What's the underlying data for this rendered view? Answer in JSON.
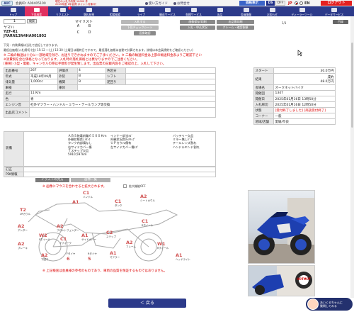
{
  "top": {
    "logo": "AUC",
    "member": "会員ID: A00405100",
    "notice_line1": "現在の入札予約数 10000 件",
    "notice_line2": "2025年度 1年会費 ポイント対象中！",
    "links": [
      "使い方ガイド",
      "お問合せ"
    ],
    "buttons": [
      "価格表示",
      "DS",
      "OFF"
    ],
    "lang_jp": "JP",
    "lang_en": "EN",
    "logout": "ログアウト"
  },
  "nav": [
    {
      "label": "トップ",
      "active": false
    },
    {
      "label": "下見検索",
      "active": true
    },
    {
      "label": "リクエスト",
      "active": false,
      "badge": "1"
    },
    {
      "label": "落札結果",
      "active": false
    },
    {
      "label": "相場検索",
      "active": false
    },
    {
      "label": "ライブ",
      "active": false
    },
    {
      "label": "輸送サービス",
      "active": false
    },
    {
      "label": "各種サービス",
      "active": false
    },
    {
      "label": "出品",
      "active": false
    },
    {
      "label": "会員情報",
      "active": false
    },
    {
      "label": "お知らせ",
      "active": false
    },
    {
      "label": "ディーラーツール",
      "active": false
    },
    {
      "label": "データサービス",
      "active": false
    }
  ],
  "lot": {
    "number": "1",
    "search": "検索",
    "maker": "ヤマハ",
    "model": "YZF-R1",
    "frame": "JYARN13N4HA001802",
    "mylist_label": "マイリスト",
    "mylist": [
      "A",
      "B",
      "C",
      "D"
    ]
  },
  "actions": {
    "row1": [
      "入札する",
      "画像保存/印刷",
      "出品票印刷"
    ],
    "row2": [
      "下見チェックシート",
      "入札・申込状況",
      "クレーム・確認依頼"
    ],
    "row3": [
      "画像確認"
    ],
    "page": "1/1",
    "top_right": "目録"
  },
  "notes": {
    "n1": "下見・内装情報は当社で追記しております。",
    "n2": "最低出価格/入札締切:(金) 15:12 ～(土) 12:30 (土曜日は最終日ですので、最低落札価格は自動で計算されます。詳細は本会員規約をご確認ください)",
    "red1": "※ 二輪の輸送は十分に一部地域を除き、お送りできかねますのでご了承ください。※ 二輪の輸送料金は上部の輸送料金表よりご確認下さい",
    "red2": "※消費税額(9,0%)",
    "red3": "※消費税を含む価格となっております。入札時の落札価格とは異なりますのでご注意ください。",
    "red4": "[重要] 小型・電動、キャンセルの際は手数料が発生致します。出品票の記載内容をご確認の上、入札して下さい。"
  },
  "spec": {
    "rows": [
      {
        "h1": "出品番号",
        "v1": "267",
        "h2": "評価点",
        "v2": "4",
        "h3": "色区分",
        "v3": "",
        "h4": "",
        "v4": ""
      },
      {
        "h1": "年式",
        "v1": "平成18年09月",
        "h2": "外装",
        "v2": "B",
        "h3": "シフト",
        "v3": "",
        "h4": "",
        "v4": ""
      },
      {
        "h1": "排気量",
        "v1": "1,000cc",
        "h2": "機関",
        "v2": "B",
        "h3": "足回り",
        "v3": "",
        "h4": "",
        "v4": ""
      },
      {
        "h1": "車検",
        "v1": "",
        "h2": "車体",
        "v2": "",
        "h3": "",
        "v3": "",
        "h4": "",
        "v4": ""
      },
      {
        "h1": "走行",
        "v1": "11 Km",
        "h2": "",
        "v2": "",
        "h3": "",
        "v3": "",
        "h4": "",
        "v4": ""
      },
      {
        "h1": "色",
        "v1": "青",
        "h2": "",
        "v2": "",
        "h3": "",
        "v3": "",
        "h4": "",
        "v4": ""
      },
      {
        "h1": "エンジン音",
        "v1": "社外マフラー・ハンドル・ミラー・テールランプ等交換",
        "h2": "",
        "v2": "",
        "h3": "",
        "v3": "",
        "h4": "",
        "v4": ""
      },
      {
        "h1": "出品店コメント",
        "v1": "",
        "h2": "",
        "v2": "",
        "h3": "",
        "v3": "",
        "h4": "",
        "v4": ""
      }
    ]
  },
  "info": {
    "start_label": "スタート",
    "start_value": "30.0万円",
    "result_label": "結果",
    "result_value_top": "成約",
    "result_value": "48.0万円",
    "rows": [
      {
        "h": "会場名",
        "v": "オークネットバイク"
      },
      {
        "h": "開催回",
        "v": "1347"
      },
      {
        "h": "開催日",
        "v": "2025年01月16日 13時50分"
      },
      {
        "h": "入札締切",
        "v": "2025年01月16日 12時50分"
      },
      {
        "h": "状態",
        "v": "[受付終了しました] [商談受付終了]",
        "red": true
      },
      {
        "h": "コーナー",
        "v": "一般"
      },
      {
        "h": "地域/店舗",
        "v": "愛媛/奈良"
      }
    ]
  },
  "equip": {
    "label": "装備",
    "col1": [
      "ＡＢＳ装着前輪６５００Ｋｍ",
      "外観状態良いﾀﾝｸ",
      "タンク内部錆なし",
      "右サイドカバー傷",
      "Ｔステップ欠品",
      "5910,597km"
    ],
    "col2": [
      "インナー部当ｷｽﾞ",
      "外観状況良ﾀｯﾁｱｯﾌﾟ",
      "ＵＰカウル傷有",
      "左サイドカバー傷ｷｽﾞ"
    ],
    "col3": [
      "バッテリー欠品",
      "ミラー無しﾊﾞﾗ",
      "テールレンズ割れ",
      "ハンドルエンド割れ"
    ]
  },
  "extra": {
    "row1": "訂正",
    "row2": "PDI情報"
  },
  "tabs": {
    "t1": "イラストの見方",
    "t2": "画像一覧"
  },
  "diagram_note": "画像にマウスを合わせると拡大されます。",
  "zoom_check": "拡大機能OFF",
  "diagram_labels": [
    {
      "code": "C1",
      "name": "ハンドル"
    },
    {
      "code": "A1",
      "name": ""
    },
    {
      "code": "C1",
      "name": "タンク"
    },
    {
      "code": "A2",
      "name": "シートカウル"
    },
    {
      "code": "T2",
      "name": "UPカウル"
    },
    {
      "code": "A2",
      "name": "アンダー"
    },
    {
      "code": "A2",
      "name": "フロントフェンダー"
    },
    {
      "code": "A2",
      "name": "ブレーキ"
    },
    {
      "code": "W2",
      "name": "Fホイール"
    },
    {
      "code": "C1",
      "name": "Fフォーク"
    },
    {
      "code": "A1",
      "name": "サイドカバー"
    },
    {
      "code": "C2",
      "name": "ステップ"
    },
    {
      "code": "C1",
      "name": "Rホイール"
    },
    {
      "code": "A2",
      "name": "フレーム"
    },
    {
      "code": "W1",
      "name": "Rホイール"
    },
    {
      "code": "A1",
      "name": "マフラー"
    },
    {
      "code": "A2",
      "name": "下回り"
    },
    {
      "code": "A1",
      "name": "ヘッドライト"
    },
    {
      "code": "6",
      "name": "Fタイヤ"
    },
    {
      "code": "5",
      "name": "Rタイヤ"
    }
  ],
  "bottom_note": "※ 上記検査は会員様の参考のものであり、車両の品質を保証するものではありません。",
  "back": "＜ 戻る",
  "chat": {
    "line1": "あいくるちゃんに",
    "line2": "質問してみる"
  },
  "photo_logo": "HOTMOT",
  "colors": {
    "nav": "#2c3a8a",
    "active": "#e03060",
    "logout": "#e52020",
    "bike_blue": "#1d3fb0"
  }
}
